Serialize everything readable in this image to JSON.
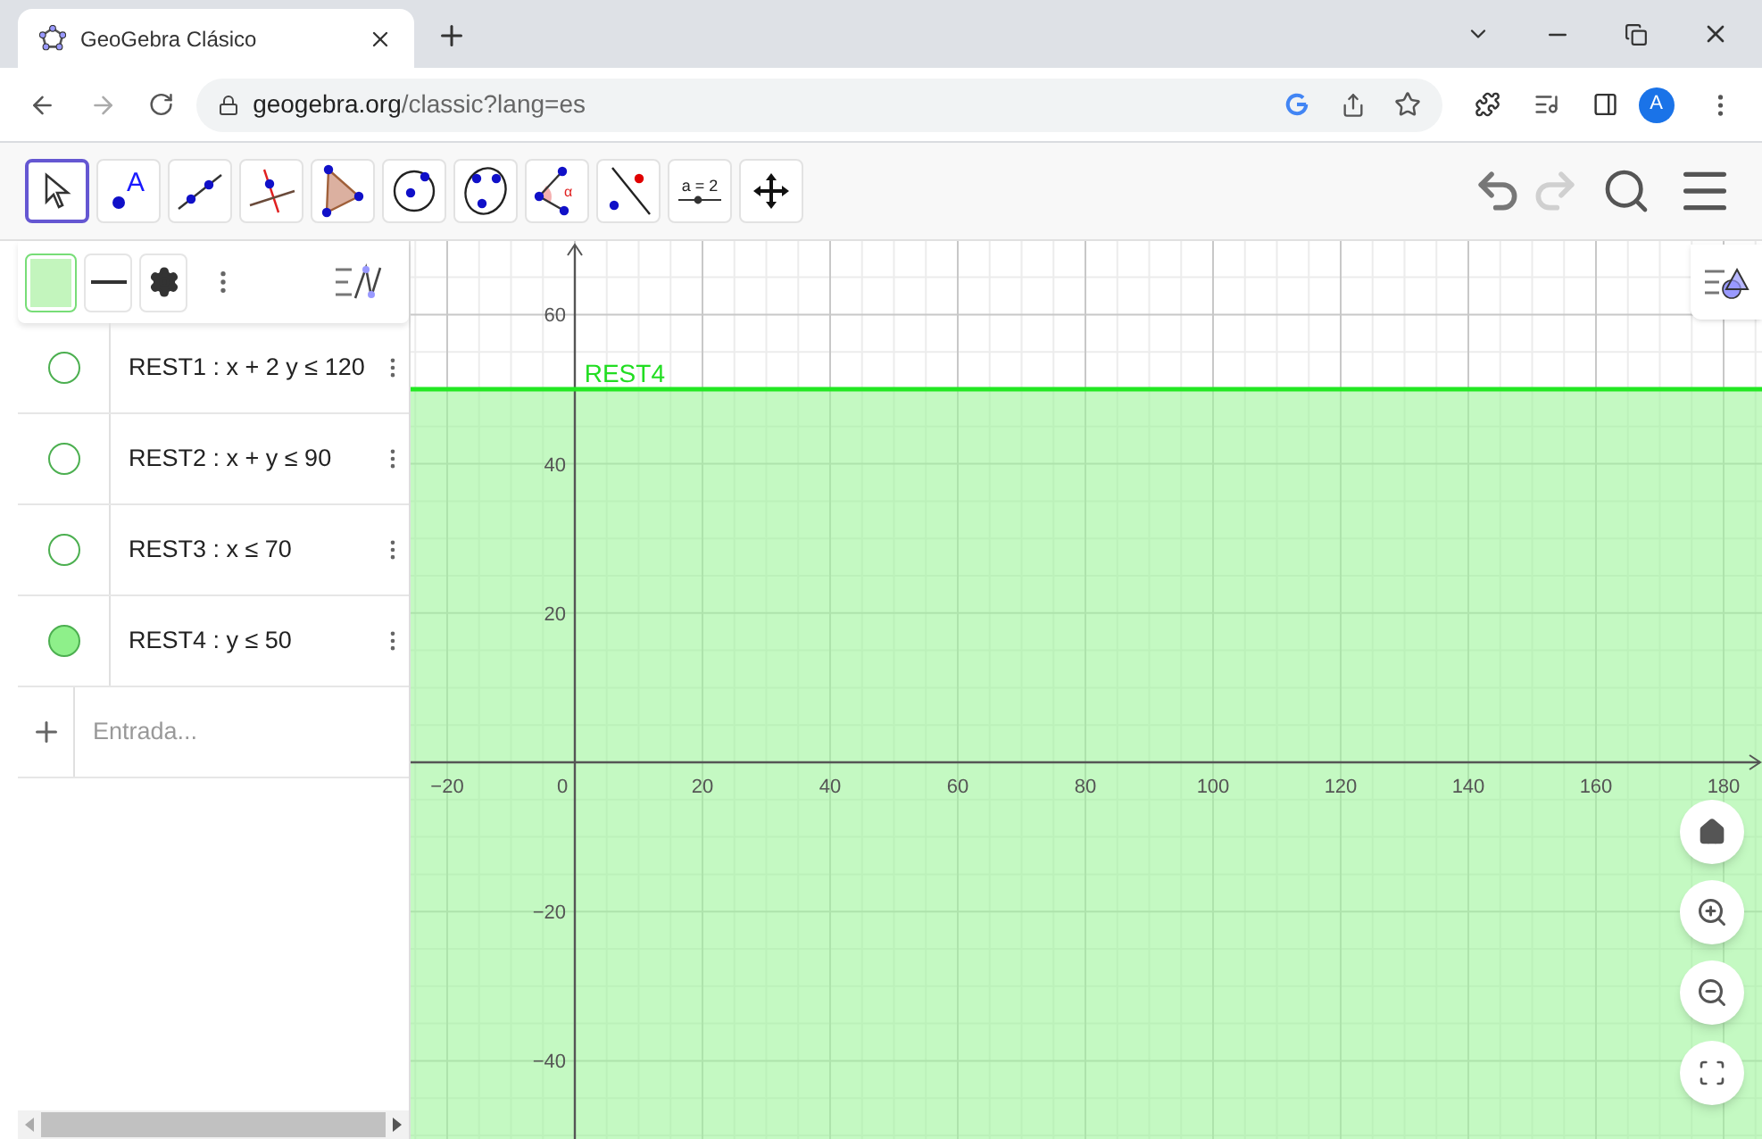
{
  "browser": {
    "tab": {
      "title": "GeoGebra Clásico"
    },
    "url": {
      "host": "geogebra.org",
      "path": "/classic?lang=es"
    },
    "avatar": "A"
  },
  "toolbar": {
    "tools": [
      {
        "kind": "move",
        "selected": true
      },
      {
        "kind": "point",
        "selected": false,
        "label": "A"
      },
      {
        "kind": "line",
        "selected": false
      },
      {
        "kind": "perpendicular",
        "selected": false
      },
      {
        "kind": "polygon",
        "selected": false
      },
      {
        "kind": "circle",
        "selected": false
      },
      {
        "kind": "conic",
        "selected": false
      },
      {
        "kind": "angle",
        "selected": false,
        "label": "α"
      },
      {
        "kind": "reflect",
        "selected": false
      },
      {
        "kind": "slider",
        "selected": false,
        "label": "a = 2"
      },
      {
        "kind": "pan",
        "selected": false
      }
    ],
    "undo": {
      "disabled": false
    },
    "redo": {
      "disabled": true
    }
  },
  "algebra": {
    "rows": [
      {
        "text": "REST1 : x + 2 y ≤ 120",
        "visible": false
      },
      {
        "text": "REST2 : x + y ≤ 90",
        "visible": false
      },
      {
        "text": "REST3 : x ≤ 70",
        "visible": false
      },
      {
        "text": "REST4 : y ≤ 50",
        "visible": true
      }
    ],
    "input": {
      "placeholder": "Entrada..."
    }
  },
  "graphics": {
    "x_ticks": [
      "−20",
      "0",
      "20",
      "40",
      "60",
      "80",
      "100",
      "120",
      "140",
      "160",
      "180"
    ],
    "y_ticks": [
      "60",
      "40",
      "20",
      "−20",
      "−40"
    ],
    "line_label": "REST4"
  }
}
